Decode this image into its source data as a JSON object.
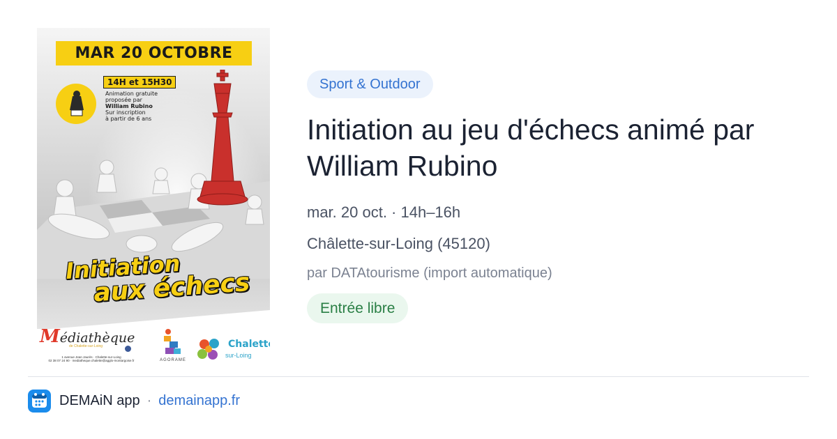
{
  "poster": {
    "date_band": "MAR 20 OCTOBRE",
    "time_band": "14H et 15H30",
    "blurb": {
      "line1": "Animation gratuite",
      "line2": "proposée par",
      "line3": "William Rubino",
      "line4": "Sur inscription",
      "line5": "à partir de 6 ans"
    },
    "title_line1": "Initiation",
    "title_line2": "aux échecs",
    "media_logo": {
      "word": "édiathèque",
      "initial": "M",
      "sub": "de Chalette-sur-Loing",
      "address": "1 avenue Jean Jaurès · Chalette-sur-Loing",
      "contact": "02 38 07 24 90 · mediatheque.chalette@agglo-montargoise.fr"
    },
    "agorame_logo": "AGORAME",
    "chalette_logo": {
      "word": "Chalette",
      "sub": "sur-Loing"
    },
    "colors": {
      "yellow": "#f7cf13",
      "red_king": "#c9302c"
    }
  },
  "event": {
    "category": "Sport & Outdoor",
    "title": "Initiation au jeu d'échecs animé par William Rubino",
    "datetime": "mar. 20 oct. · 14h–16h",
    "location": "Châlette-sur-Loing (45120)",
    "source": "par DATAtourisme (import automatique)",
    "price": "Entrée libre"
  },
  "footer": {
    "app_icon": "demain-app-icon",
    "app_name": "DEMAiN app",
    "separator": "·",
    "link": "demainapp.fr"
  },
  "colors": {
    "category_bg": "#ebf2fc",
    "category_text": "#3473d1",
    "price_bg": "#eaf7ee",
    "price_text": "#2a7f45",
    "link": "#3473d1",
    "app_icon_bg": "#1b8cec"
  }
}
